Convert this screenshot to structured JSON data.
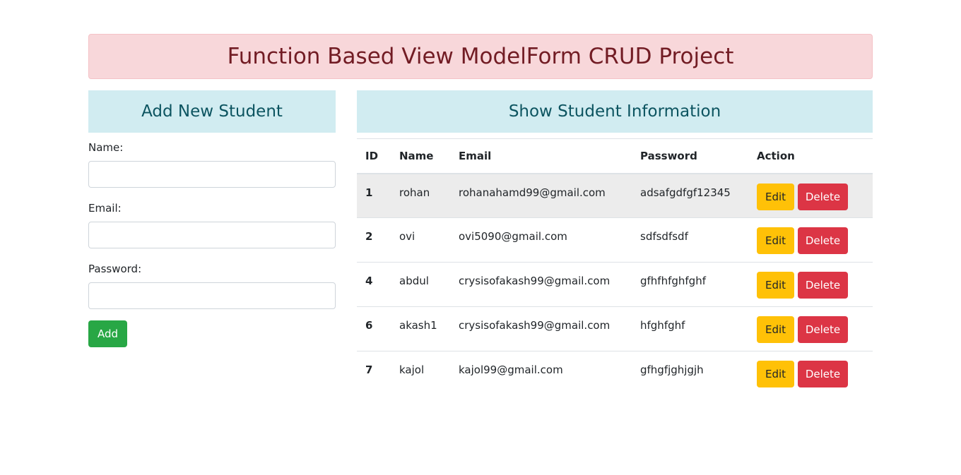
{
  "banner": {
    "title": "Function Based View ModelForm CRUD Project"
  },
  "add_panel": {
    "heading": "Add New Student",
    "fields": [
      {
        "label": "Name:",
        "value": ""
      },
      {
        "label": "Email:",
        "value": ""
      },
      {
        "label": "Password:",
        "value": ""
      }
    ],
    "submit_label": "Add"
  },
  "show_panel": {
    "heading": "Show Student Information",
    "columns": [
      "ID",
      "Name",
      "Email",
      "Password",
      "Action"
    ],
    "rows": [
      {
        "id": "1",
        "name": "rohan",
        "email": "rohanahamd99@gmail.com",
        "password": "adsafgdfgf12345"
      },
      {
        "id": "2",
        "name": "ovi",
        "email": "ovi5090@gmail.com",
        "password": "sdfsdfsdf"
      },
      {
        "id": "4",
        "name": "abdul",
        "email": "crysisofakash99@gmail.com",
        "password": "gfhfhfghfghf"
      },
      {
        "id": "6",
        "name": "akash1",
        "email": "crysisofakash99@gmail.com",
        "password": "hfghfghf"
      },
      {
        "id": "7",
        "name": "kajol",
        "email": "kajol99@gmail.com",
        "password": "gfhgfjghjgjh"
      }
    ],
    "edit_label": "Edit",
    "delete_label": "Delete"
  },
  "colors": {
    "banner_bg": "#f8d7da",
    "banner_text": "#721c24",
    "section_bg": "#d1ecf1",
    "section_text": "#0c5460",
    "add_button": "#28a745",
    "edit_button": "#ffc107",
    "delete_button": "#dc3545"
  }
}
